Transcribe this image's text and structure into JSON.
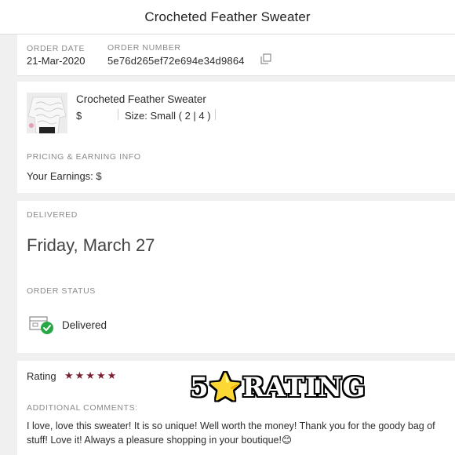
{
  "header": {
    "title": "Crocheted Feather Sweater"
  },
  "order": {
    "date_label": "ORDER DATE",
    "date_value": "21-Mar-2020",
    "number_label": "ORDER NUMBER",
    "number_value": "5e76d265ef72e694e34d9864",
    "copy_icon": "copy-icon"
  },
  "product": {
    "name": "Crocheted Feather Sweater",
    "price": "$",
    "size": "Size: Small ( 2 | 4 )"
  },
  "pricing": {
    "label": "PRICING & EARNING INFO",
    "earnings": "Your Earnings: $"
  },
  "delivered": {
    "label": "DELIVERED",
    "date": "Friday, March 27"
  },
  "status": {
    "label": "ORDER STATUS",
    "value": "Delivered",
    "icon": "delivered-box-check-icon",
    "check_color": "#27a745"
  },
  "rating": {
    "label": "Rating",
    "stars": "★★★★★",
    "star_count": 5,
    "star_color": "#7a1f2f",
    "overlay": "5⭐RATING",
    "comments_label": "ADDITIONAL COMMENTS:",
    "comment": "I love, love this sweater! It is so unique! Well worth the money! Thank you for the goody bag of stuff! Love it! Always a pleasure shopping in your boutique!😊"
  }
}
